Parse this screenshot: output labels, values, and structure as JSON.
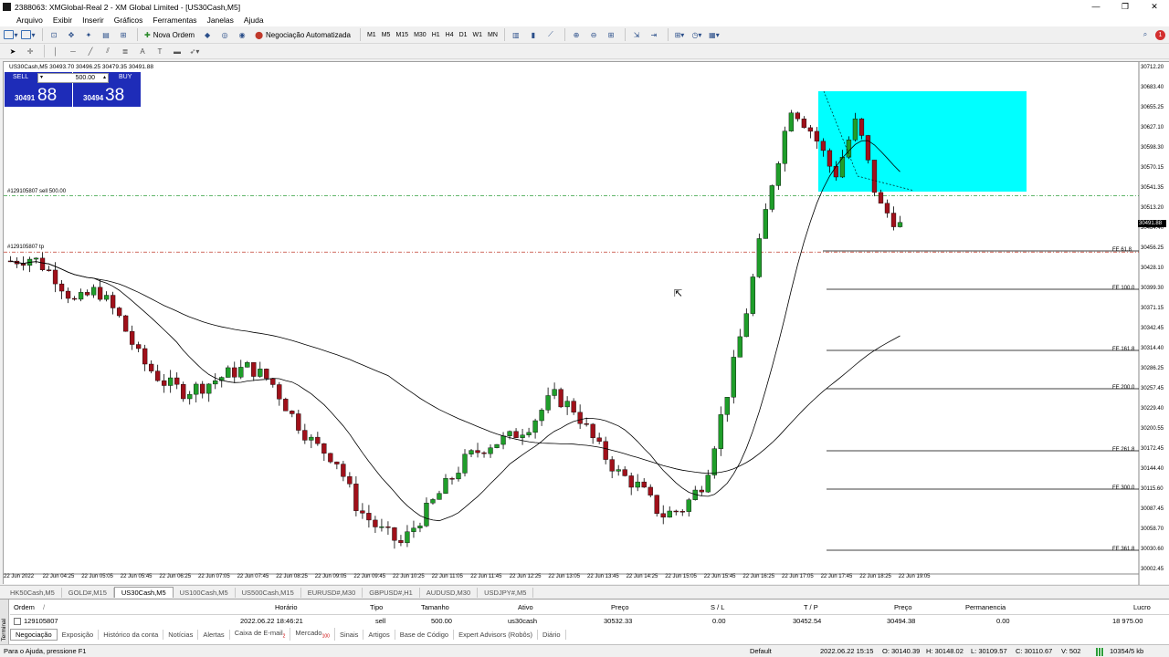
{
  "window": {
    "title": "2388063: XMGlobal-Real 2 - XM Global Limited - [US30Cash,M5]",
    "controls": [
      "—",
      "❐",
      "✕"
    ]
  },
  "menu": [
    "Arquivo",
    "Exibir",
    "Inserir",
    "Gráficos",
    "Ferramentas",
    "Janelas",
    "Ajuda"
  ],
  "toolbar": {
    "new_order": "Nova Ordem",
    "autotrading": "Negociação Automatizada",
    "timeframes": [
      "M1",
      "M5",
      "M15",
      "M30",
      "H1",
      "H4",
      "D1",
      "W1",
      "MN"
    ],
    "notification_count": "1"
  },
  "chart": {
    "header": "US30Cash,M5  30493.70 30496.25 30479.35 30491.88",
    "symbol": "US30Cash",
    "timeframe": "M5",
    "current_price": "30491.88",
    "y_ticks": [
      "30712.20",
      "30683.40",
      "30655.25",
      "30627.10",
      "30598.30",
      "30570.15",
      "30541.35",
      "30513.20",
      "30484.40",
      "30456.25",
      "30428.10",
      "30399.30",
      "30371.15",
      "30342.45",
      "30314.40",
      "30286.25",
      "30257.45",
      "30229.40",
      "30200.55",
      "30172.45",
      "30144.40",
      "30115.60",
      "30087.45",
      "30058.70",
      "30030.60",
      "30002.45"
    ],
    "x_ticks": [
      "22 Jun 2022",
      "22 Jun 04:25",
      "22 Jun 05:05",
      "22 Jun 05:45",
      "22 Jun 06:25",
      "22 Jun 07:05",
      "22 Jun 07:45",
      "22 Jun 08:25",
      "22 Jun 09:05",
      "22 Jun 09:45",
      "22 Jun 10:25",
      "22 Jun 11:05",
      "22 Jun 11:45",
      "22 Jun 12:25",
      "22 Jun 13:05",
      "22 Jun 13:45",
      "22 Jun 14:25",
      "22 Jun 15:05",
      "22 Jun 15:45",
      "22 Jun 16:25",
      "22 Jun 17:05",
      "22 Jun 17:45",
      "22 Jun 18:25",
      "22 Jun 19:05"
    ],
    "order_label_sell": "#129105807 sell 500.00",
    "order_label_tp": "#129105807 tp",
    "fe_levels": [
      {
        "label": "FE 61.8"
      },
      {
        "label": "FE 100.0"
      },
      {
        "label": "FE 161.8"
      },
      {
        "label": "FE 200.0"
      },
      {
        "label": "FE 261.8"
      },
      {
        "label": "FE 300.0"
      },
      {
        "label": "FE 361.8"
      }
    ],
    "colors": {
      "bull": "#1f9e2a",
      "bear": "#a0101a",
      "rectangle": "#00ffff",
      "sell_line": "#2e9e3a",
      "tp_line": "#c0392b"
    }
  },
  "chart_data": {
    "type": "candlestick",
    "symbol": "US30Cash",
    "timeframe": "M5",
    "ohlc_last": {
      "open": 30493.7,
      "high": 30496.25,
      "low": 30479.35,
      "close": 30491.88
    },
    "ylim": [
      30002.45,
      30712.2
    ],
    "path_estimate": [
      30440,
      30445,
      30420,
      30380,
      30400,
      30360,
      30300,
      30270,
      30255,
      30265,
      30280,
      30290,
      30270,
      30220,
      30180,
      30160,
      30090,
      30060,
      30040,
      30080,
      30120,
      30160,
      30180,
      30190,
      30210,
      30250,
      30230,
      30180,
      30140,
      30120,
      30080,
      30090,
      30130,
      30250,
      30380,
      30540,
      30660,
      30620,
      30560,
      30640,
      30520,
      30490
    ],
    "sell_entry": 30532.33,
    "take_profit": 30452.54
  },
  "oneclick": {
    "sell_label": "SELL",
    "buy_label": "BUY",
    "volume": "500.00",
    "sell_small": "30491",
    "sell_big": "88",
    "buy_small": "30494",
    "buy_big": "38"
  },
  "symbol_tabs": [
    "HK50Cash,M5",
    "GOLD#,M15",
    "US30Cash,M5",
    "US100Cash,M5",
    "US500Cash,M15",
    "EURUSD#,M30",
    "GBPUSD#,H1",
    "AUDUSD,M30",
    "USDJPY#,M5"
  ],
  "terminal": {
    "side_label": "Terminal",
    "headers": {
      "ordem": "Ordem",
      "horario": "Horário",
      "tipo": "Tipo",
      "tamanho": "Tamanho",
      "ativo": "Ativo",
      "preco": "Preço",
      "sl": "S / L",
      "tp": "T / P",
      "preco2": "Preço",
      "permanencia": "Permanencia",
      "lucro": "Lucro"
    },
    "row": {
      "ordem": "129105807",
      "horario": "2022.06.22 18:46:21",
      "tipo": "sell",
      "tamanho": "500.00",
      "ativo": "us30cash",
      "preco": "30532.33",
      "sl": "0.00",
      "tp": "30452.54",
      "preco2": "30494.38",
      "permanencia": "0.00",
      "lucro": "18 975.00"
    },
    "tabs": [
      "Negociação",
      "Exposição",
      "Histórico da conta",
      "Notícias",
      "Alertas",
      "Caixa de E-mail",
      "Mercado",
      "Sinais",
      "Artigos",
      "Base de Código",
      "Expert Advisors (Robôs)",
      "Diário"
    ],
    "badges": {
      "email": "2",
      "market": "100"
    }
  },
  "status": {
    "help": "Para o Ajuda, pressione F1",
    "profile": "Default",
    "datetime": "2022.06.22 15:15",
    "open": "O: 30140.39",
    "high": "H: 30148.02",
    "low": "L: 30109.57",
    "close": "C: 30110.67",
    "volume": "V: 502",
    "traffic": "10354/5 kb"
  }
}
